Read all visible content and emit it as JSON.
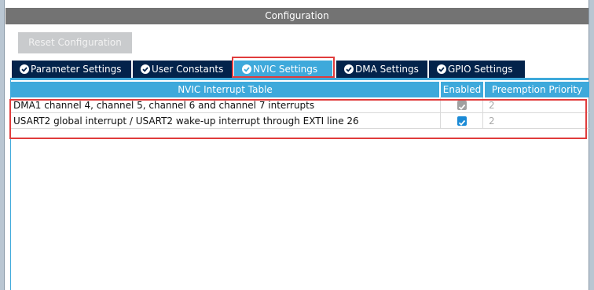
{
  "panel": {
    "title": "Configuration"
  },
  "toolbar": {
    "reset_label": "Reset Configuration"
  },
  "tabs": [
    {
      "label": "Parameter Settings",
      "icon": "check-circle-icon"
    },
    {
      "label": "User Constants",
      "icon": "check-circle-icon"
    },
    {
      "label": "NVIC Settings",
      "icon": "check-circle-icon",
      "active": true
    },
    {
      "label": "DMA Settings",
      "icon": "check-circle-icon"
    },
    {
      "label": "GPIO Settings",
      "icon": "check-circle-icon"
    }
  ],
  "table": {
    "headers": [
      "NVIC Interrupt Table",
      "Enabled",
      "Preemption Priority"
    ],
    "rows": [
      {
        "name": "DMA1 channel 4, channel 5, channel 6 and channel 7 interrupts",
        "enabled": true,
        "enabled_editable": false,
        "priority": "2"
      },
      {
        "name": "USART2 global interrupt / USART2 wake-up interrupt through EXTI line 26",
        "enabled": true,
        "enabled_editable": true,
        "priority": "2"
      }
    ]
  },
  "colors": {
    "header_bar": "#737373",
    "tab_inactive": "#03234b",
    "tab_active": "#3ea9db",
    "highlight": "#e03c3c"
  }
}
